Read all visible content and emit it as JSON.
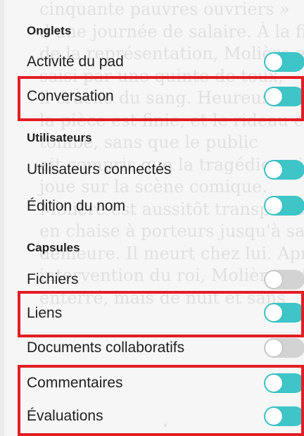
{
  "tabs_section": {
    "title": "Onglets",
    "items": [
      {
        "label": "Activité du pad",
        "enabled": true
      },
      {
        "label": "Conversation",
        "enabled": true
      }
    ]
  },
  "users_section": {
    "title": "Utilisateurs",
    "items": [
      {
        "label": "Utilisateurs connectés",
        "enabled": true
      },
      {
        "label": "Édition du nom",
        "enabled": true
      }
    ]
  },
  "capsules_section": {
    "title": "Capsules",
    "items": [
      {
        "label": "Fichiers",
        "enabled": false
      },
      {
        "label": "Liens",
        "enabled": true
      },
      {
        "label": "Documents collaboratifs",
        "enabled": false
      },
      {
        "label": "Commentaires",
        "enabled": true
      },
      {
        "label": "Évaluations",
        "enabled": true
      }
    ]
  },
  "background_text": "cinquante pauvres ouvriers »\nd'une journée de salaire. À la fin\nde la représentation, Molière est\nsaisi par une quinte de toux,\nil crache du sang. Heureusement\nla pièce est finie, et le rideau est\ntombé, sans que le public\nait compris que la tragédie qui se\njoue sur la scène comique.\nMolière est aussitôt transporté\nen chaise à porteurs jusqu'à sa\ndemeure. Il meurt chez lui. Après\nintervention du roi, Molière est\nenterré, mais de nuit et sans",
  "colors": {
    "toggle_on": "#3ec5c7",
    "toggle_off": "#d3d3d3",
    "highlight": "#e31d24",
    "text": "#1f1f1f"
  },
  "icons": {
    "caret": "˅"
  }
}
